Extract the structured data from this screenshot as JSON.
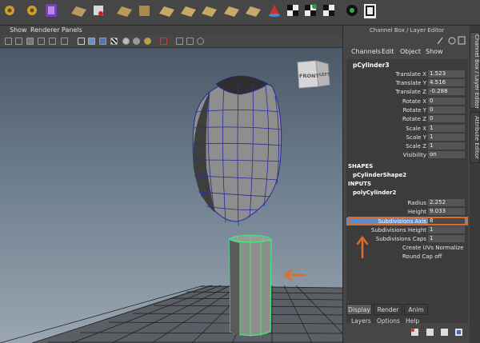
{
  "viewport": {
    "menu": [
      "Show",
      "Renderer",
      "Panels"
    ],
    "view_cube_labels": [
      "FRONT",
      "LEFT"
    ]
  },
  "channel_box": {
    "title": "Channel Box / Layer Editor",
    "menu": [
      "Channels",
      "Edit",
      "Object",
      "Show"
    ],
    "object_name": "pCylinder3",
    "attributes": [
      {
        "label": "Translate X",
        "value": "1.523"
      },
      {
        "label": "Translate Y",
        "value": "4.516"
      },
      {
        "label": "Translate Z",
        "value": "-0.288"
      },
      {
        "label": "Rotate X",
        "value": "0"
      },
      {
        "label": "Rotate Y",
        "value": "0"
      },
      {
        "label": "Rotate Z",
        "value": "0"
      },
      {
        "label": "Scale X",
        "value": "1"
      },
      {
        "label": "Scale Y",
        "value": "1"
      },
      {
        "label": "Scale Z",
        "value": "1"
      },
      {
        "label": "Visibility",
        "value": "on"
      }
    ],
    "shapes_header": "SHAPES",
    "shape_name": "pCylinderShape2",
    "inputs_header": "INPUTS",
    "input_name": "polyCylinder2",
    "input_attributes": [
      {
        "label": "Radius",
        "value": "2.252"
      },
      {
        "label": "Height",
        "value": "9.033"
      },
      {
        "label": "Subdivisions Axis",
        "value": "8"
      },
      {
        "label": "Subdivisions Height",
        "value": "1"
      },
      {
        "label": "Subdivisions Caps",
        "value": "1"
      }
    ],
    "extra_rows": [
      "Create UVs Normalize ...",
      "Round Cap off"
    ]
  },
  "side_tabs": [
    "Channel Box / Layer Editor",
    "Attribute Editor"
  ],
  "layer_editor": {
    "tabs": [
      "Display",
      "Render",
      "Anim"
    ],
    "menu": [
      "Layers",
      "Options",
      "Help"
    ]
  },
  "colors": {
    "annotation_orange": "#e06a2a",
    "wireframe_blue": "#3a3aa8",
    "selected_green": "#3cf07a"
  }
}
